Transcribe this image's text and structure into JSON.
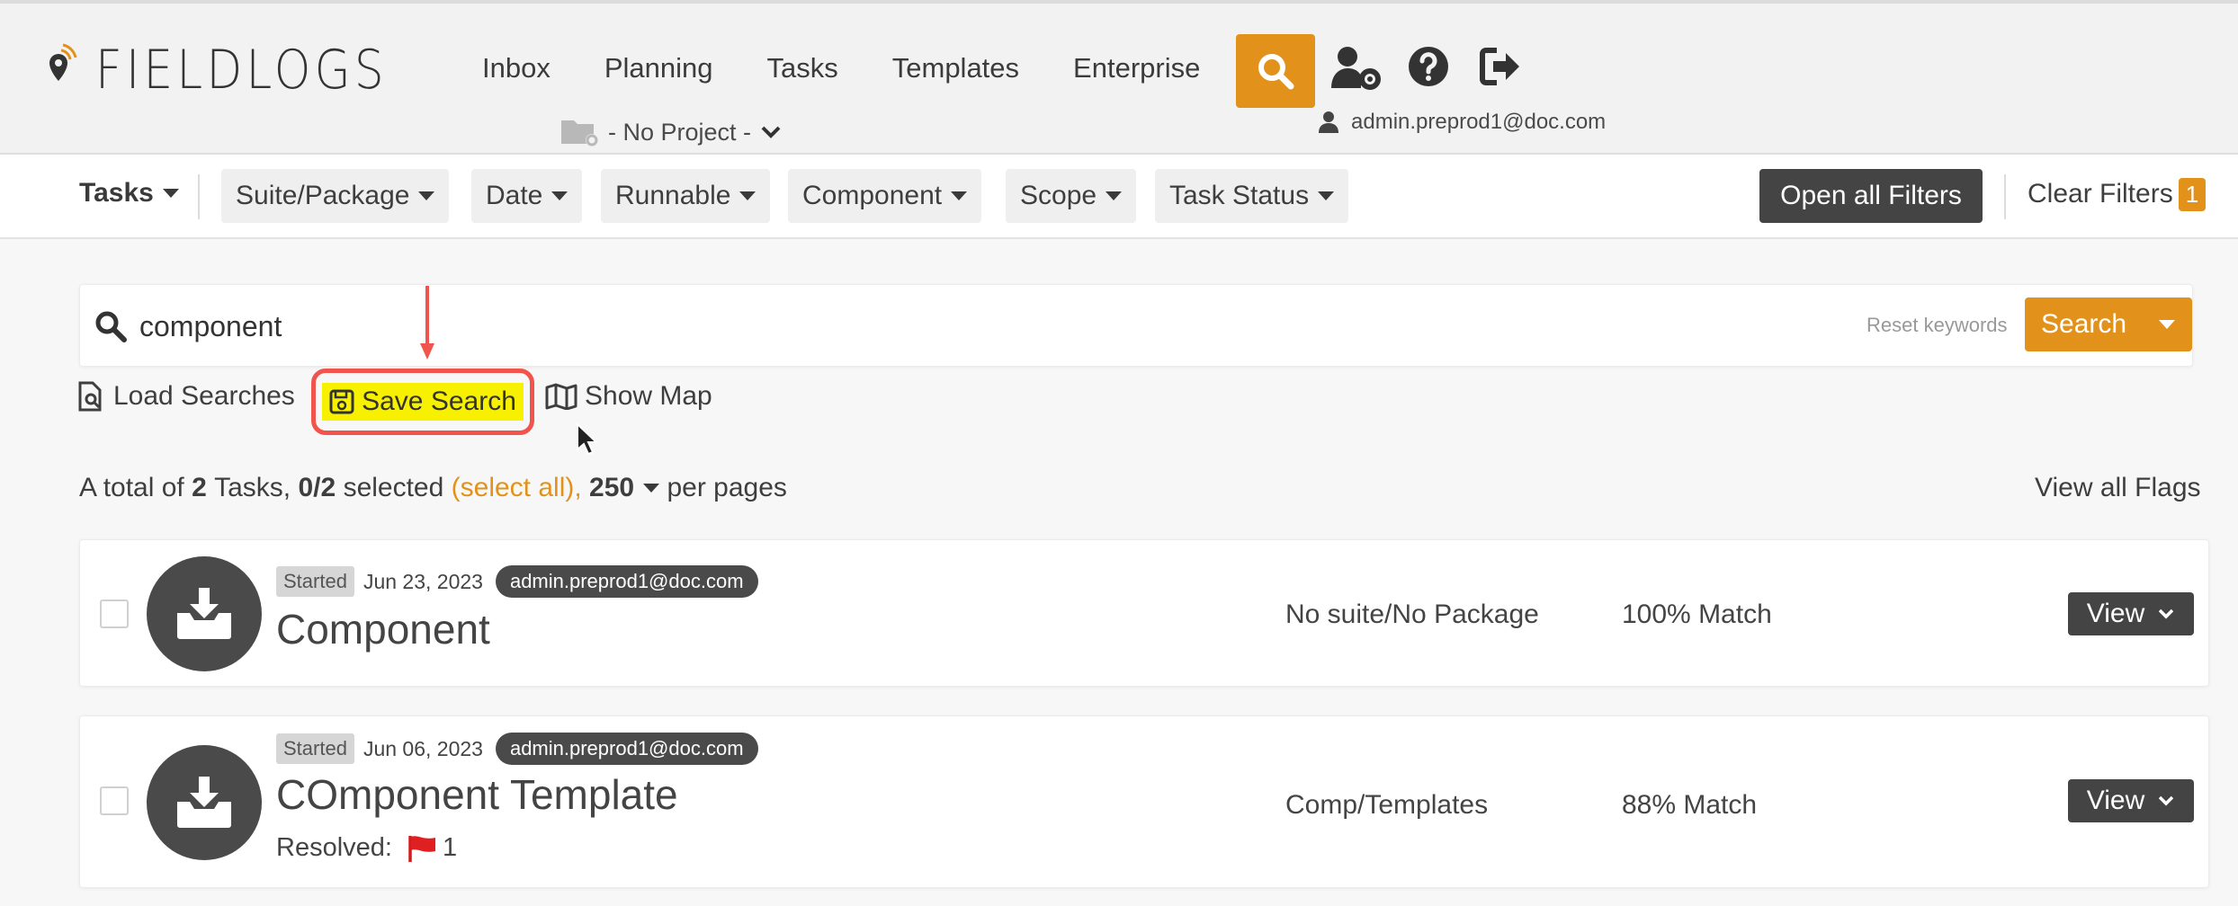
{
  "header": {
    "logo_text": "FIELDLOGS",
    "nav": [
      "Inbox",
      "Planning",
      "Tasks",
      "Templates",
      "Enterprise"
    ],
    "project_label": "- No Project -",
    "user_email": "admin.preprod1@doc.com",
    "icons": [
      "search-icon",
      "user-settings-icon",
      "help-icon",
      "logout-icon"
    ],
    "accent_color": "#e2921a"
  },
  "filters": {
    "tasks_label": "Tasks",
    "chips": [
      "Suite/Package",
      "Date",
      "Runnable",
      "Component",
      "Scope",
      "Task Status"
    ],
    "open_all": "Open all Filters",
    "clear": "Clear Filters",
    "clear_count": "1"
  },
  "search": {
    "query": "component",
    "reset_label": "Reset keywords",
    "button_label": "Search"
  },
  "actions": {
    "load": "Load Searches",
    "save": "Save Search",
    "map": "Show Map"
  },
  "summary": {
    "prefix": "A total of",
    "count": "2",
    "tasks_word": "Tasks,",
    "selected": "0/2",
    "selected_word": "selected",
    "select_all": "(select all),",
    "per_page": "250",
    "per_page_word": "per pages",
    "view_flags": "View all Flags"
  },
  "tasks": [
    {
      "status": "Started",
      "date": "Jun 23, 2023",
      "owner": "admin.preprod1@doc.com",
      "title": "Component",
      "suite": "No suite/No Package",
      "match": "100% Match",
      "view": "View"
    },
    {
      "status": "Started",
      "date": "Jun 06, 2023",
      "owner": "admin.preprod1@doc.com",
      "title": "COmponent Template",
      "resolved_label": "Resolved:",
      "resolved_count": "1",
      "suite": "Comp/Templates",
      "match": "88% Match",
      "view": "View"
    }
  ]
}
